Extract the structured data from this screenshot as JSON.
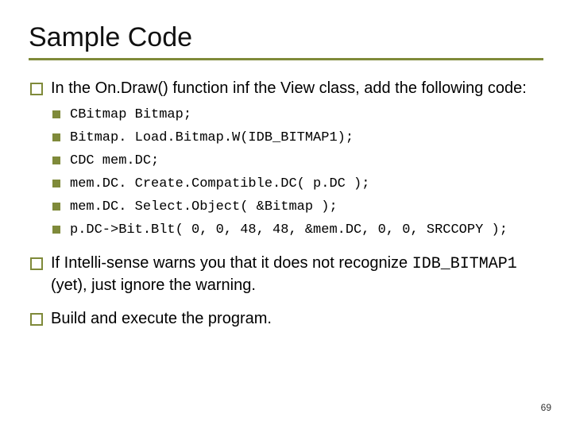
{
  "title": "Sample Code",
  "bullets": {
    "b1": "In the On.Draw() function inf the View class, add the following code:",
    "code": {
      "c1": "CBitmap Bitmap;",
      "c2": "Bitmap. Load.Bitmap.W(IDB_BITMAP1);",
      "c3": "CDC mem.DC;",
      "c4": "mem.DC. Create.Compatible.DC( p.DC );",
      "c5": "mem.DC. Select.Object( &Bitmap );",
      "c6": "p.DC->Bit.Blt( 0, 0, 48, 48, &mem.DC, 0, 0, SRCCOPY );"
    },
    "b2_pre": "If Intelli-sense warns you that it does not recognize ",
    "b2_code": "IDB_BITMAP1",
    "b2_post": " (yet), just ignore the warning.",
    "b3": "Build and execute the program."
  },
  "page_number": "69"
}
